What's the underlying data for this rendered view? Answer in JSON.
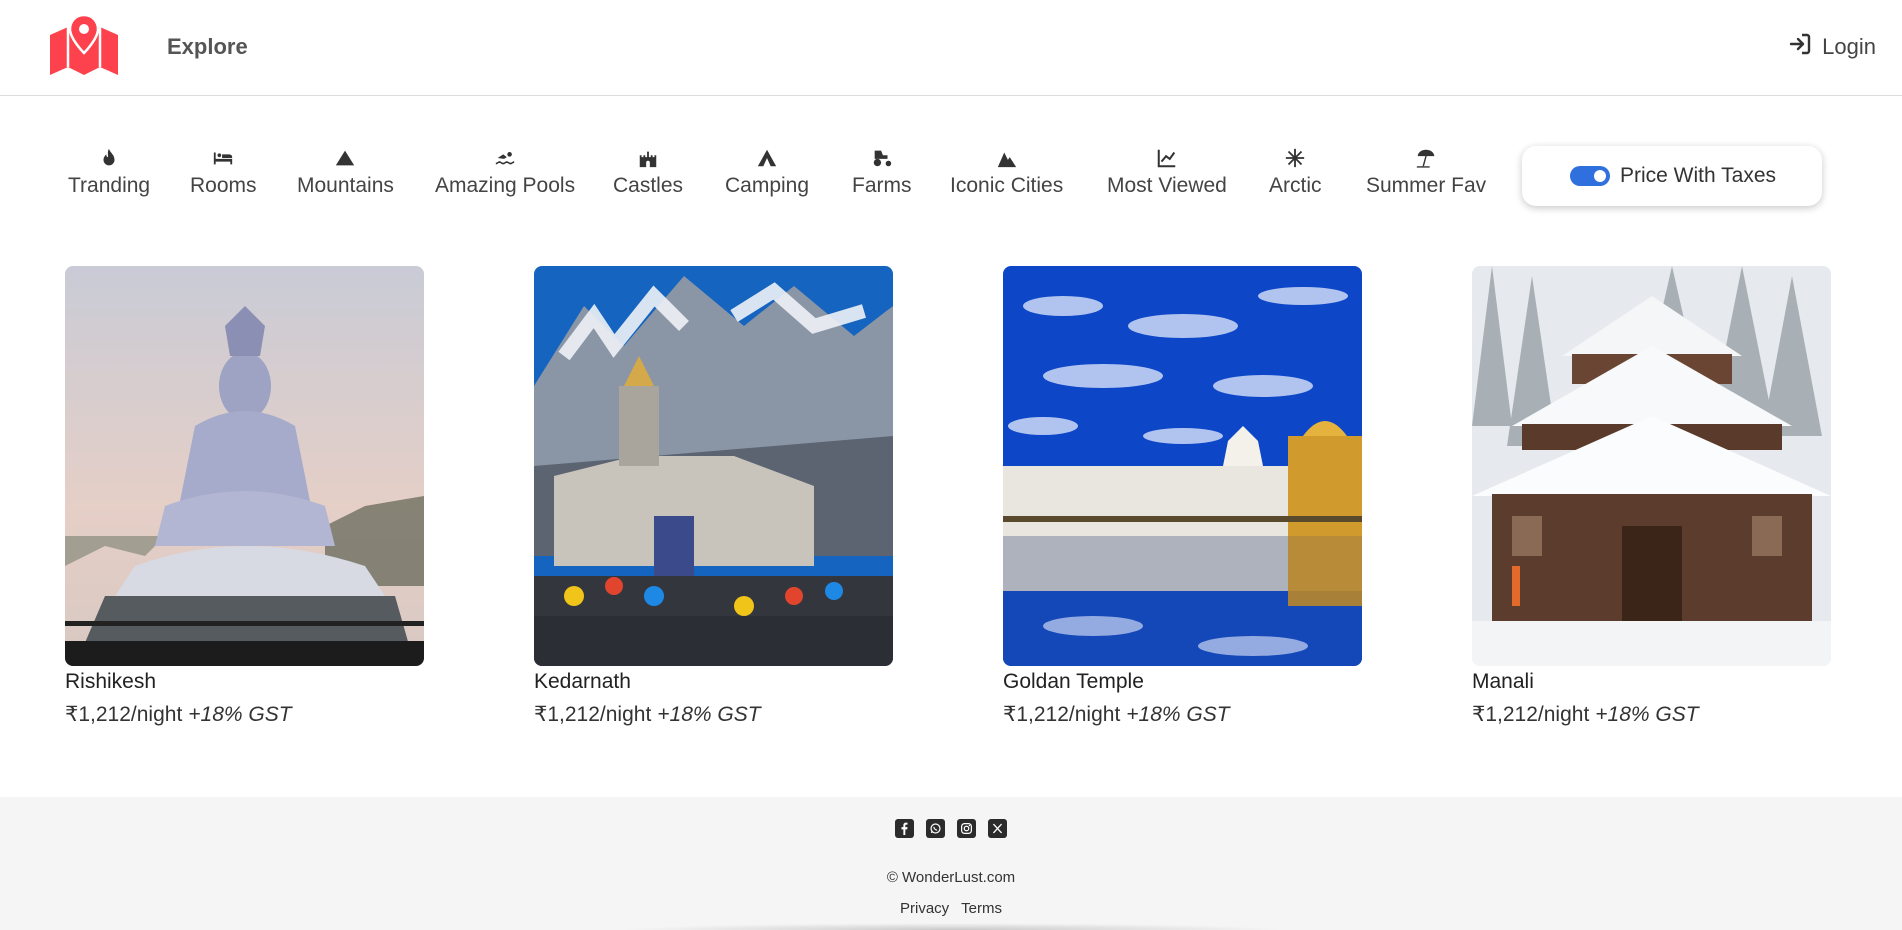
{
  "brand": {
    "accent": "#fe424d"
  },
  "nav": {
    "explore_label": "Explore",
    "login_label": "Login"
  },
  "filters": [
    {
      "label": "Tranding",
      "icon": "fire-icon"
    },
    {
      "label": "Rooms",
      "icon": "bed-icon"
    },
    {
      "label": "Mountains",
      "icon": "mountain-icon"
    },
    {
      "label": "Amazing Pools",
      "icon": "swimmer-icon"
    },
    {
      "label": "Castles",
      "icon": "castle-icon"
    },
    {
      "label": "Camping",
      "icon": "tent-icon"
    },
    {
      "label": "Farms",
      "icon": "tractor-icon"
    },
    {
      "label": "Iconic Cities",
      "icon": "city-icon"
    },
    {
      "label": "Most Viewed",
      "icon": "chart-line-icon"
    },
    {
      "label": "Arctic",
      "icon": "snowflake-icon"
    },
    {
      "label": "Summer Fav",
      "icon": "beach-umbrella-icon"
    }
  ],
  "tax_toggle": {
    "label": "Price With Taxes",
    "enabled": true
  },
  "listings": [
    {
      "title": "Rishikesh",
      "price": "₹1,212/night",
      "gst": "+18% GST"
    },
    {
      "title": "Kedarnath",
      "price": "₹1,212/night",
      "gst": "+18% GST"
    },
    {
      "title": "Goldan Temple",
      "price": "₹1,212/night",
      "gst": "+18% GST"
    },
    {
      "title": "Manali",
      "price": "₹1,212/night",
      "gst": "+18% GST"
    }
  ],
  "footer": {
    "socials": [
      "facebook-icon",
      "whatsapp-icon",
      "instagram-icon",
      "x-twitter-icon"
    ],
    "copyright": "© WonderLust.com",
    "links": [
      "Privacy",
      "Terms"
    ]
  }
}
